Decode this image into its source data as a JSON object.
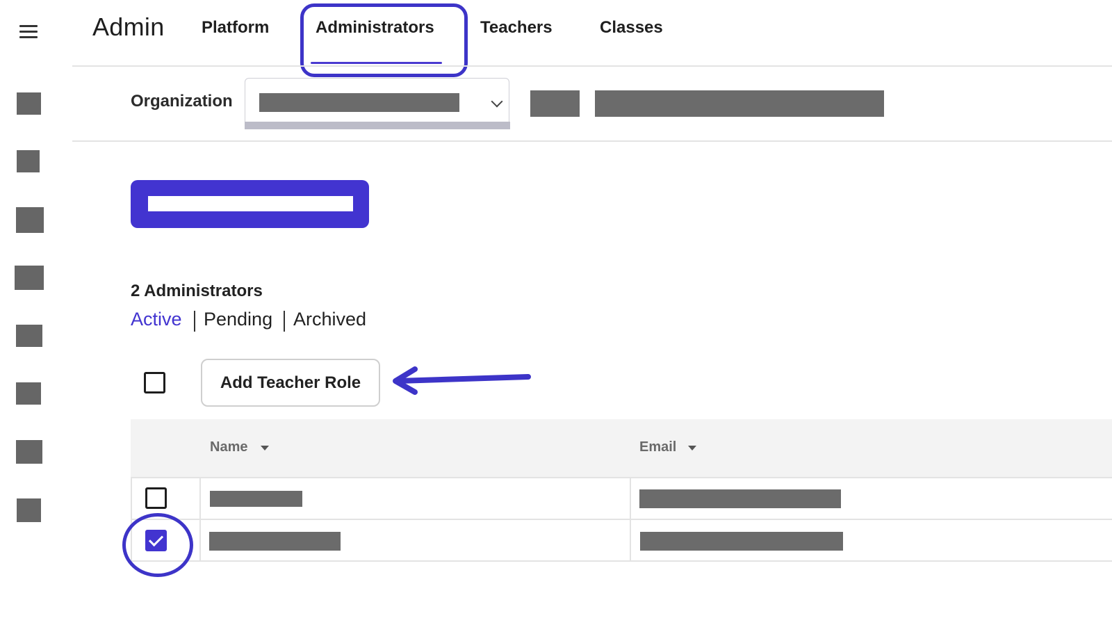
{
  "app": {
    "title": "Admin"
  },
  "nav": {
    "menu_icon": "hamburger-icon",
    "tabs": [
      {
        "label": "Platform",
        "active": false
      },
      {
        "label": "Administrators",
        "active": true
      },
      {
        "label": "Teachers",
        "active": false
      },
      {
        "label": "Classes",
        "active": false
      }
    ]
  },
  "rail": {
    "icons": [
      "redacted-icon",
      "redacted-icon",
      "redacted-icon",
      "redacted-icon",
      "redacted-icon",
      "redacted-icon",
      "redacted-icon",
      "redacted-icon"
    ]
  },
  "filter_bar": {
    "organization_label": "Organization",
    "select_icon": "chevron-down-icon"
  },
  "admins": {
    "count_label": "2 Administrators",
    "filters": [
      {
        "label": "Active",
        "active": true
      },
      {
        "label": "Pending",
        "active": false
      },
      {
        "label": "Archived",
        "active": false
      }
    ],
    "add_teacher_role_label": "Add Teacher Role"
  },
  "table": {
    "columns": [
      {
        "label": "Name",
        "sort_icon": "caret-down-icon"
      },
      {
        "label": "Email",
        "sort_icon": "caret-down-icon"
      }
    ],
    "rows": [
      {
        "checked": false
      },
      {
        "checked": true
      }
    ]
  },
  "colors": {
    "accent": "#4234d0",
    "annotation": "#3d34c8",
    "redaction": "#6b6b6b"
  }
}
